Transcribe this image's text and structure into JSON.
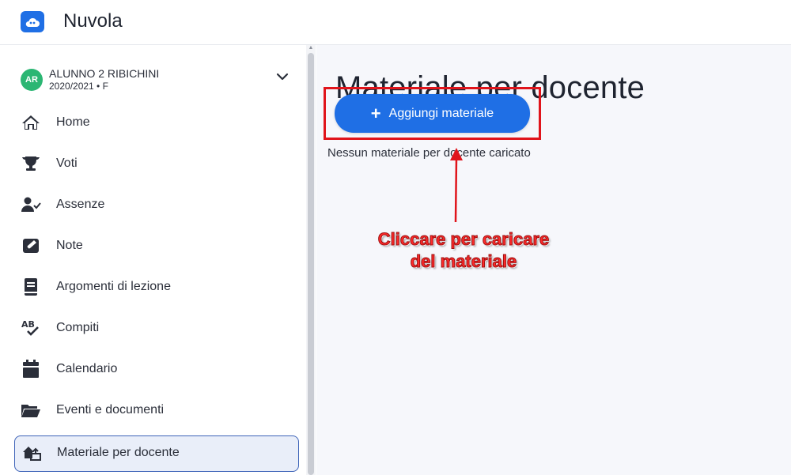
{
  "app": {
    "name": "Nuvola"
  },
  "user": {
    "initials": "AR",
    "name": "ALUNNO 2 RIBICHINI",
    "year": "2020/2021 • F"
  },
  "sidebar": {
    "items": [
      {
        "label": "Home",
        "icon": "home-icon"
      },
      {
        "label": "Voti",
        "icon": "trophy-icon"
      },
      {
        "label": "Assenze",
        "icon": "user-check-icon"
      },
      {
        "label": "Note",
        "icon": "note-icon"
      },
      {
        "label": "Argomenti di lezione",
        "icon": "book-icon"
      },
      {
        "label": "Compiti",
        "icon": "spellcheck-icon"
      },
      {
        "label": "Calendario",
        "icon": "calendar-icon"
      },
      {
        "label": "Eventi e documenti",
        "icon": "folder-open-icon"
      },
      {
        "label": "Materiale per docente",
        "icon": "house-upload-icon",
        "active": true
      }
    ]
  },
  "main": {
    "title": "Materiale per docente",
    "add_button": "Aggiungi materiale",
    "empty_message": "Nessun materiale per docente caricato"
  },
  "annotation": {
    "line1": "Cliccare per caricare",
    "line2": "del materiale"
  },
  "colors": {
    "primary": "#1f6fe5",
    "accent_red": "#e0141b",
    "active_bg": "#e9eef9",
    "avatar_green": "#2bb673"
  }
}
